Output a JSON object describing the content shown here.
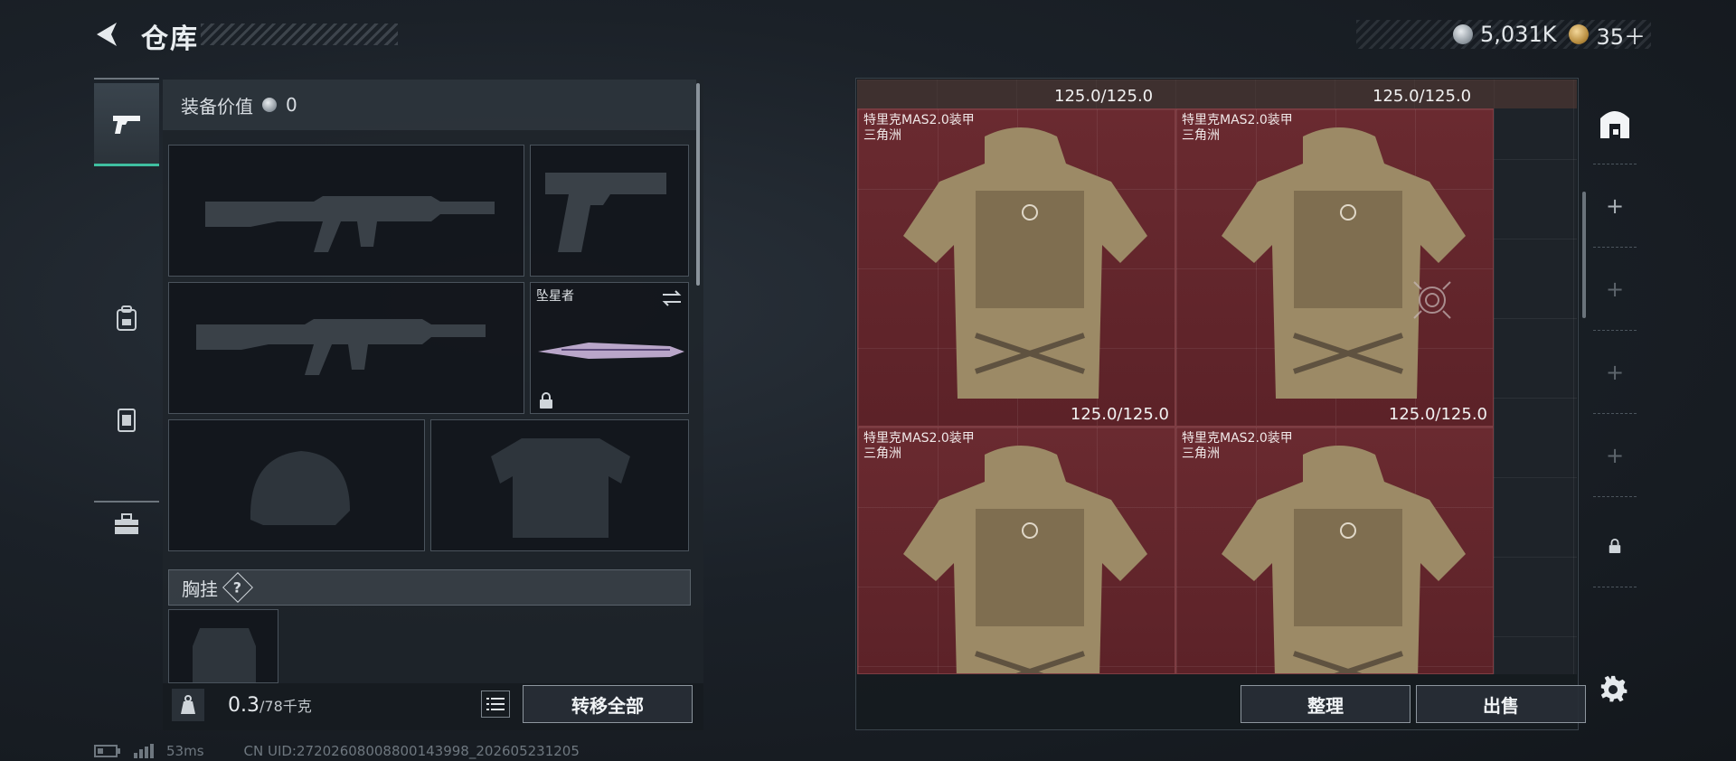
{
  "header": {
    "title": "仓库",
    "currencies": [
      {
        "icon": "silver-coin-icon",
        "value": "5,031K"
      },
      {
        "icon": "gold-coin-icon",
        "value": "35＋"
      }
    ]
  },
  "rail": {
    "items": [
      {
        "name": "weapon-icon",
        "active": true
      },
      {
        "name": "backpack-icon",
        "active": false
      },
      {
        "name": "chest-rig-icon",
        "active": false
      },
      {
        "name": "toolbox-icon",
        "active": false
      }
    ]
  },
  "loadout": {
    "equip_value_label": "装备价值",
    "equip_value": "0",
    "melee_name": "坠星者",
    "chest_rig_label": "胸挂",
    "help": "?",
    "weight_current": "0.3",
    "weight_max": "/78千克",
    "transfer_all": "转移全部"
  },
  "storage": {
    "top_durability": [
      "125.0/125.0",
      "125.0/125.0"
    ],
    "items": [
      {
        "name": "特里克MAS2.0装甲",
        "sub": "三角洲",
        "durability": "125.0/125.0"
      },
      {
        "name": "特里克MAS2.0装甲",
        "sub": "三角洲",
        "durability": "125.0/125.0"
      },
      {
        "name": "特里克MAS2.0装甲",
        "sub": "三角洲",
        "durability": ""
      },
      {
        "name": "特里克MAS2.0装甲",
        "sub": "三角洲",
        "durability": ""
      }
    ],
    "sort_label": "整理",
    "sell_label": "出售",
    "tabs": [
      "+",
      "+",
      "+",
      "+"
    ]
  },
  "footer": {
    "ping": "53ms",
    "uid": "CN UID:27202608008800143998_202605231205"
  },
  "colors": {
    "accent": "#3fbfa0",
    "item_bg": "#6a2a30"
  }
}
